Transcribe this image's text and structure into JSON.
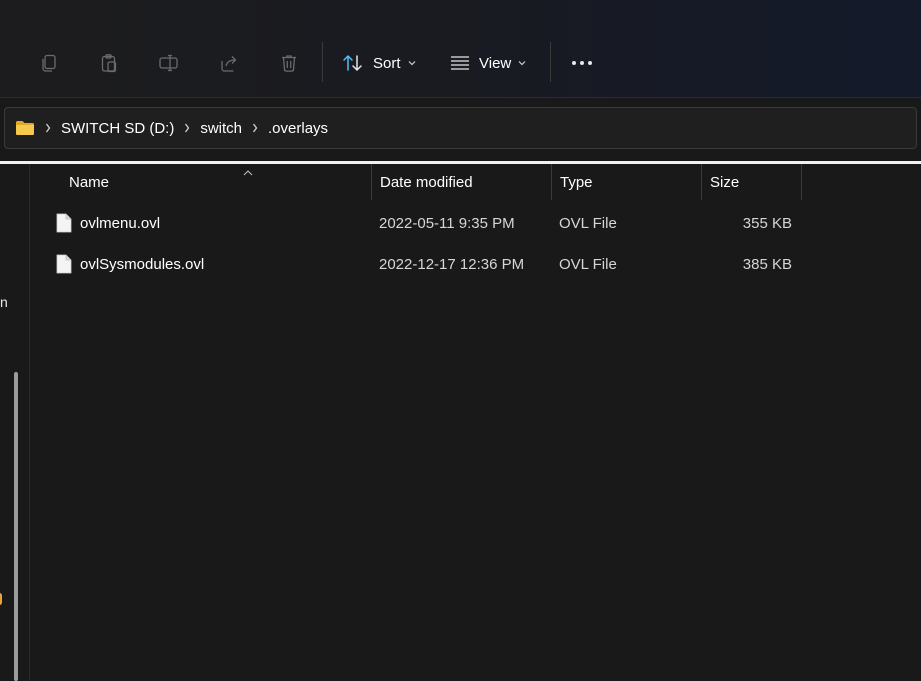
{
  "toolbar": {
    "icons": [
      "copy-icon",
      "paste-icon",
      "rename-icon",
      "share-icon",
      "delete-icon"
    ],
    "sort_label": "Sort",
    "view_label": "View",
    "more_icon": "more-icon"
  },
  "address": {
    "folder_icon": "folder-icon",
    "crumbs": [
      "SWITCH SD (D:)",
      "switch",
      ".overlays"
    ]
  },
  "nav": {
    "fragment": "n"
  },
  "columns": {
    "name": "Name",
    "date": "Date modified",
    "type": "Type",
    "size": "Size"
  },
  "files": [
    {
      "name": "ovlmenu.ovl",
      "date": "2022-05-11 9:35 PM",
      "type": "OVL File",
      "size": "355 KB"
    },
    {
      "name": "ovlSysmodules.ovl",
      "date": "2022-12-17 12:36 PM",
      "type": "OVL File",
      "size": "385 KB"
    }
  ],
  "colors": {
    "accent": "#4cc2ff",
    "folder": "#f0c050",
    "background": "#191919"
  }
}
